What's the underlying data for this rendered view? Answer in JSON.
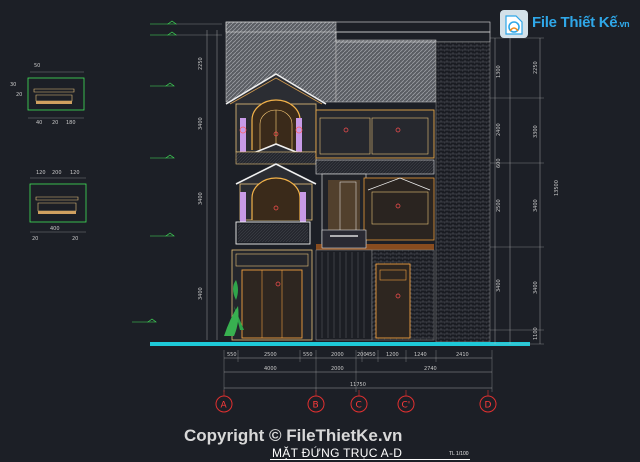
{
  "drawing": {
    "title": "MẶT ĐỨNG TRỤC A-D",
    "scale": "TL 1/100",
    "axes": [
      "A",
      "B",
      "C",
      "C'",
      "D"
    ],
    "dims_bottom_row1": [
      "550",
      "2500",
      "550",
      "2000",
      "200",
      "450",
      "1200",
      "1240",
      "2410"
    ],
    "dims_bottom_row2": [
      "4000",
      "2000",
      "2740"
    ],
    "dims_total": "11750",
    "dims_right_outer": [
      "2250",
      "3300",
      "3400",
      "3400",
      "1100"
    ],
    "dims_right_total": "13500",
    "dims_right_inner": [
      "1300",
      "2400",
      "600",
      "2500",
      "3400"
    ]
  },
  "detail1": {
    "dims": [
      "50",
      "30",
      "20",
      "40",
      "20",
      "180"
    ]
  },
  "detail2": {
    "dims": [
      "120",
      "200",
      "120",
      "20",
      "400",
      "20"
    ]
  },
  "watermark": {
    "logo_main": "File Thiết Kế",
    "logo_suffix": ".vn",
    "copyright": "Copyright © FileThietKe.vn"
  },
  "colors": {
    "background": "#1c1f26",
    "ground_line": "#1ec9d8",
    "axis_circle": "#e03030",
    "outline": "#e8c27a",
    "roof": "#9a9a9a"
  }
}
